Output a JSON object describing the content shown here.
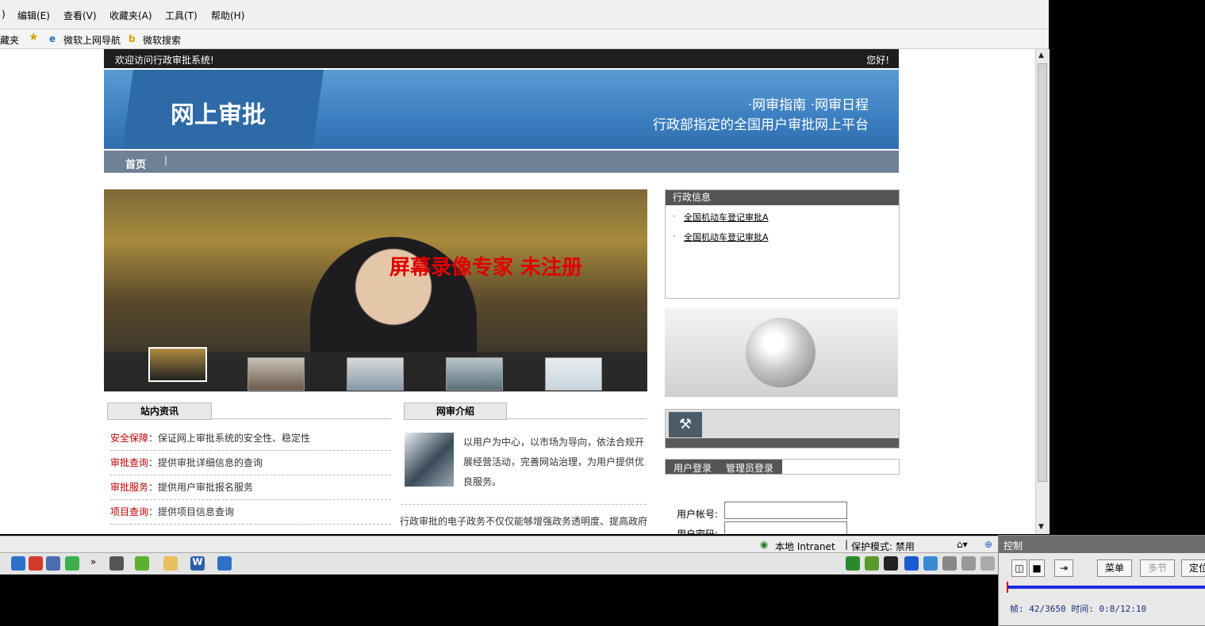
{
  "menubar": {
    "items": [
      ")",
      "编辑(E)",
      "查看(V)",
      "收藏夹(A)",
      "工具(T)",
      "帮助(H)"
    ]
  },
  "favbar": {
    "label": "藏夹",
    "links": [
      "微软上网导航",
      "微软搜索"
    ]
  },
  "page": {
    "welcome": "欢迎访问行政审批系统!",
    "greeting": "您好!",
    "banner_title": "网上审批",
    "banner_links": "·网审指南 ·网审日程",
    "banner_slogan": "行政部指定的全国用户审批网上平台",
    "nav_home": "首页",
    "watermark": "屏幕录像专家  未注册",
    "admin_info_title": "行政信息",
    "admin_info_links": [
      "全国机动车登记审批A",
      "全国机动车登记审批A"
    ],
    "news_tab": "站内资讯",
    "news": [
      {
        "key": "安全保障",
        "text": "保证网上审批系统的安全性、稳定性"
      },
      {
        "key": "审批查询",
        "text": "提供审批详细信息的查询"
      },
      {
        "key": "审批服务",
        "text": "提供用户审批报名服务"
      },
      {
        "key": "项目查询",
        "text": "提供项目信息查询"
      }
    ],
    "intro_tab": "网审介绍",
    "intro_text": "以用户为中心，以市场为导向，依法合规开展经营活动，完善网站治理，为用户提供优良服务。",
    "intro_text2": "行政审批的电子政务不仅仅能够增强政务透明度、提高政府",
    "login_tabs": [
      "用户登录",
      "管理员登录"
    ],
    "username_label": "用户帐号:",
    "password_label": "用户密码:"
  },
  "statusbar": {
    "zone": "本地 Intranet",
    "protected_mode": "保护模式: 禁用"
  },
  "control": {
    "title": "控制",
    "menu_button": "菜单",
    "segment_button": "多节",
    "locate_button": "定位",
    "frame_info": "帧: 42/3650 时间: 0:8/12:10"
  },
  "colors": {
    "banner_blue": "#3c7fc0",
    "nav_gray": "#6f8197",
    "news_key_red": "#c00000",
    "watermark_red": "#e00000"
  }
}
